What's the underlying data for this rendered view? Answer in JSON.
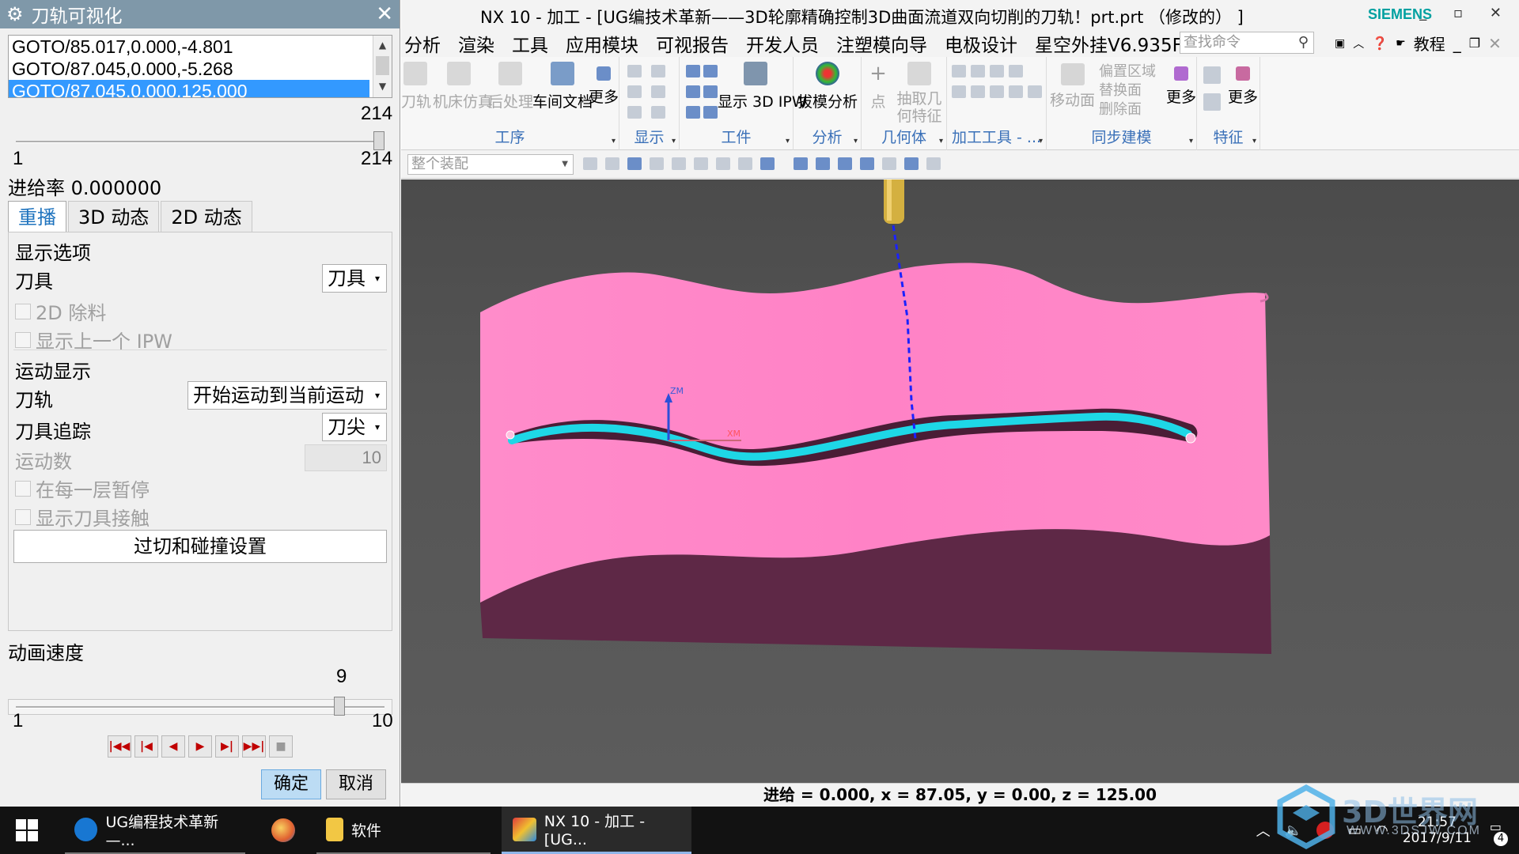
{
  "dialog": {
    "title": "刀轨可视化",
    "goto_rows": [
      "GOTO/85.017,0.000,-4.801",
      "GOTO/87.045,0.000,-5.268",
      "GOTO/87.045,0.000,125.000"
    ],
    "step_slider": {
      "value": "214",
      "min": "1",
      "max": "214",
      "fraction": 1.0
    },
    "feed_rate": "进给率 0.000000",
    "tabs": [
      "重播",
      "3D 动态",
      "2D 动态"
    ],
    "active_tab": "重播",
    "display_options": {
      "title": "显示选项",
      "tool_label": "刀具",
      "tool_value": "刀具",
      "remove_2d": "2D 除料",
      "show_prev_ipw": "显示上一个 IPW"
    },
    "motion_display": {
      "title": "运动显示",
      "toolpath_label": "刀轨",
      "toolpath_value": "开始运动到当前运动",
      "trace_label": "刀具追踪",
      "trace_value": "刀尖",
      "motion_count_label": "运动数",
      "motion_count_value": "10",
      "pause_each_layer": "在每一层暂停",
      "show_tool_contact": "显示刀具接触"
    },
    "gouge_button": "过切和碰撞设置",
    "speed": {
      "label": "动画速度",
      "value": "9",
      "min": "1",
      "max": "10",
      "fraction": 0.889
    },
    "transport_icons": [
      "rewind-start-icon",
      "step-back-icon",
      "play-reverse-icon",
      "play-icon",
      "step-forward-icon",
      "fast-forward-end-icon",
      "stop-icon"
    ],
    "ok": "确定",
    "cancel": "取消"
  },
  "nx": {
    "title": "NX 10 - 加工 - [UG编技术革新——3D轮廓精确控制3D曲面流道双向切削的刀轨！prt.prt （修改的） ]",
    "brand": "SIEMENS",
    "window_buttons": "_ ▫ ✕",
    "menus": [
      "分析",
      "渲染",
      "工具",
      "应用模块",
      "可视报告",
      "开发人员",
      "注塑模向导",
      "电极设计",
      "星空外挂V6.935F"
    ],
    "search_placeholder": "查找命令",
    "tutorial": "教程",
    "ribbon": {
      "op_buttons": [
        "刀轨",
        "机床仿真",
        "后处理",
        "车间文档",
        "更多"
      ],
      "group_op": "工序",
      "group_display": "显示",
      "show_ipw": "显示 3D IPW",
      "group_workpiece": "工件",
      "draft_analysis": "拔模分析",
      "group_analysis": "分析",
      "point": "点",
      "extract_geom": "抽取几何特征",
      "group_geometry": "几何体",
      "group_machining_tools": "加工工具 - ...",
      "move_face": "移动面",
      "offset_region": "偏置区域",
      "replace_face": "替换面",
      "delete_face": "删除面",
      "more": "更多",
      "group_sync": "同步建模",
      "group_feature": "特征"
    },
    "assembly_filter": "整个装配",
    "axis_z": "ZM",
    "axis_x": "XM",
    "status": "进给 = 0.000, x = 87.05, y = 0.00, z = 125.00"
  },
  "taskbar": {
    "tasks": [
      "UG编程技术革新—...",
      "软件",
      "NX 10 - 加工 - [UG..."
    ],
    "time": "21:57",
    "date": "2017/9/11",
    "notifications": "4",
    "watermark": "3D世界网",
    "watermark_url": "WWW.3DSJW.COM"
  },
  "colors": {
    "title_bar": "#7f98a9",
    "selection": "#3399ff",
    "part_pink": "#ff85c8",
    "part_side": "#5e2846",
    "channel": "#1ed7e6",
    "tool": "#d4b040",
    "ribbon_label": "#3a70b8"
  }
}
